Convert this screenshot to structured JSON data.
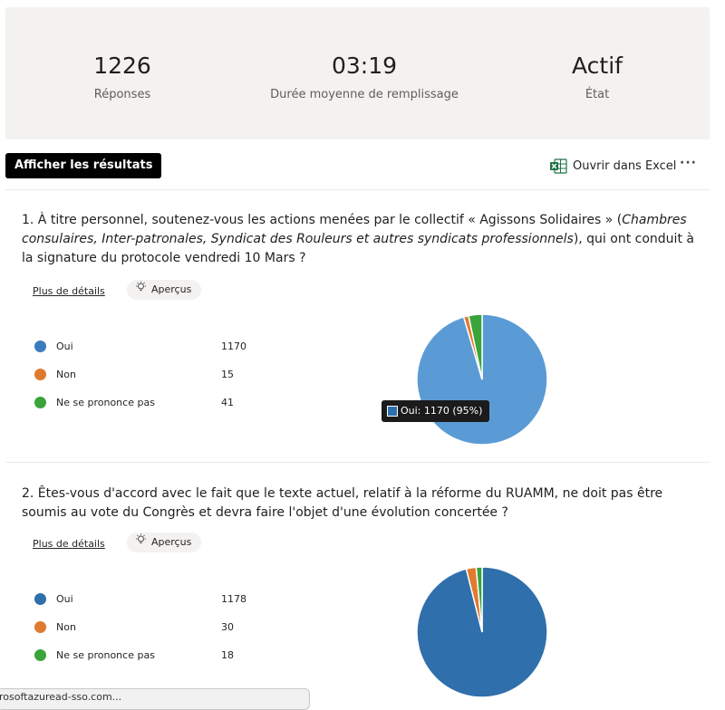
{
  "stats": [
    {
      "value": "1226",
      "label": "Réponses"
    },
    {
      "value": "03:19",
      "label": "Durée moyenne de remplissage"
    },
    {
      "value": "Actif",
      "label": "État"
    }
  ],
  "toolbar": {
    "results_button": "Afficher les résultats",
    "excel_label": "Ouvrir dans Excel",
    "more_label": "···"
  },
  "questions": [
    {
      "text_a": "1. À titre personnel, soutenez-vous les actions menées par le collectif « Agissons Solidaires » (",
      "text_italic": "Chambres consulaires, Inter-patronales, Syndicat des Rouleurs et autres syndicats professionnels",
      "text_b": "), qui ont conduit à la signature du protocole vendredi 10 Mars ?",
      "details_link": "Plus de détails",
      "apercus": "Aperçus",
      "options": [
        {
          "name": "Oui",
          "count": "1170",
          "color": "#3a7bc0"
        },
        {
          "name": "Non",
          "count": "15",
          "color": "#e07a2f"
        },
        {
          "name": "Ne se prononce pas",
          "count": "41",
          "color": "#3aa33a"
        }
      ],
      "tooltip": "Oui: 1170 (95%)"
    },
    {
      "text_a": "2. Êtes-vous d'accord avec le fait que le texte actuel, relatif à la réforme du RUAMM, ne doit pas être soumis au vote du Congrès et devra faire l'objet d'une évolution concertée ?",
      "text_italic": "",
      "text_b": "",
      "details_link": "Plus de détails",
      "apercus": "Aperçus",
      "options": [
        {
          "name": "Oui",
          "count": "1178",
          "color": "#2f6fab"
        },
        {
          "name": "Non",
          "count": "30",
          "color": "#e07a2f"
        },
        {
          "name": "Ne se prononce pas",
          "count": "18",
          "color": "#3aa33a"
        }
      ]
    }
  ],
  "status_url": "rosoftazuread-sso.com...",
  "chart_data": [
    {
      "type": "pie",
      "categories": [
        "Oui",
        "Non",
        "Ne se prononce pas"
      ],
      "values": [
        1170,
        15,
        41
      ],
      "colors": [
        "#5b9bd5",
        "#e07a2f",
        "#3aa33a"
      ]
    },
    {
      "type": "pie",
      "categories": [
        "Oui",
        "Non",
        "Ne se prononce pas"
      ],
      "values": [
        1178,
        30,
        18
      ],
      "colors": [
        "#2f6fab",
        "#e07a2f",
        "#3aa33a"
      ]
    }
  ]
}
